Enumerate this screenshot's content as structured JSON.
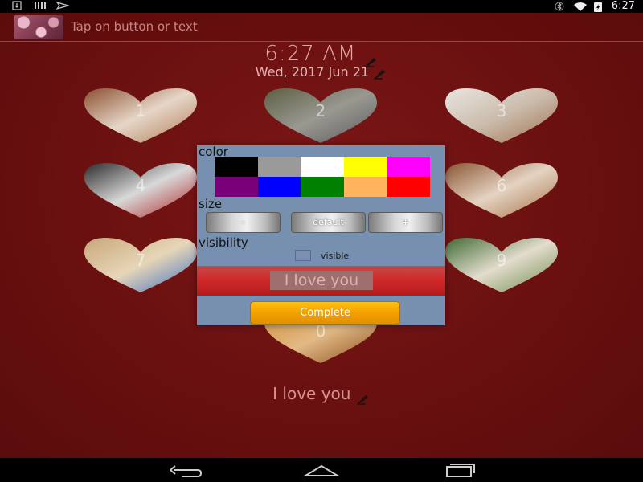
{
  "status_bar": {
    "time": "6:27",
    "left_icons": [
      "download-icon",
      "barcode-icon",
      "send-icon"
    ],
    "right_icons": [
      "bluetooth-icon",
      "wifi-icon",
      "battery-icon"
    ]
  },
  "toolbar": {
    "title": "Tap on button or text"
  },
  "clock": {
    "time": "6:27 AM",
    "date": "Wed, 2017 Jun 21"
  },
  "hearts": [
    {
      "num": "1"
    },
    {
      "num": "2"
    },
    {
      "num": "3"
    },
    {
      "num": "4"
    },
    {
      "num": "6"
    },
    {
      "num": "7"
    },
    {
      "num": "9"
    },
    {
      "num": "0"
    }
  ],
  "message": "I love you",
  "panel": {
    "color_label": "color",
    "size_label": "size",
    "visibility_label": "visibility",
    "colors": [
      "#000000",
      "#9a9a9a",
      "#ffffff",
      "#ffff00",
      "#ff00ff",
      "#7a007a",
      "#0000ff",
      "#008000",
      "#ffb35c",
      "#ff0000"
    ],
    "size_buttons": [
      "-",
      "default",
      "+"
    ],
    "visible_label": "visible",
    "visible_checked": false,
    "preview_text": "I love you",
    "complete_label": "Complete"
  },
  "nav": {
    "icons": [
      "back-icon",
      "home-icon",
      "recents-icon"
    ]
  }
}
